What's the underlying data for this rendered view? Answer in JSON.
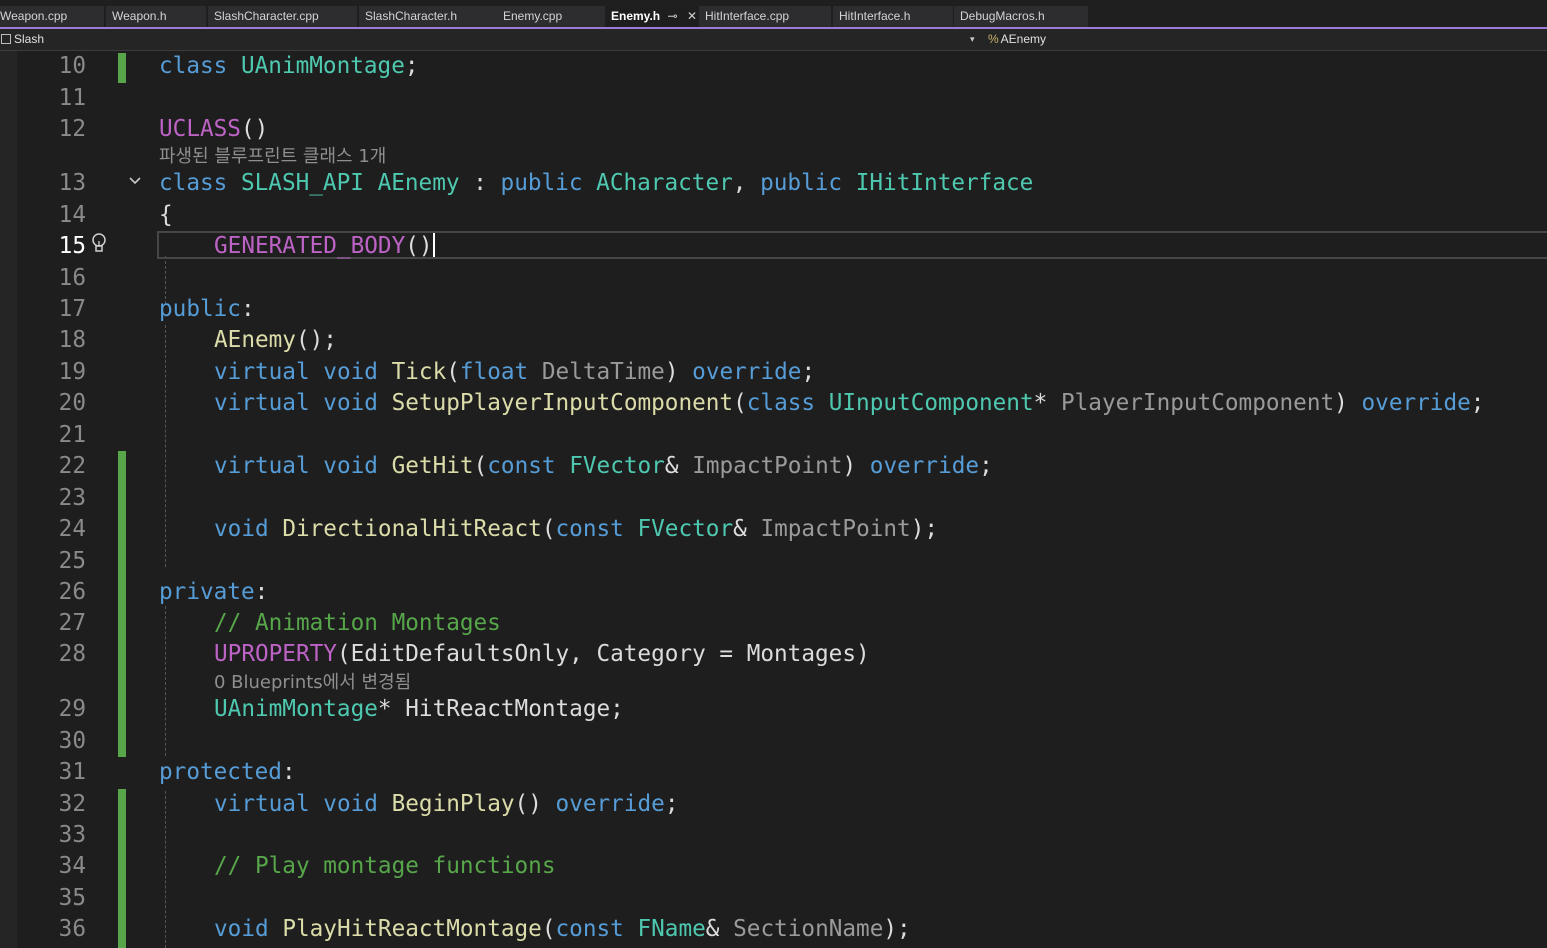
{
  "tabs": [
    {
      "label": "Weapon.cpp"
    },
    {
      "label": "Weapon.h"
    },
    {
      "label": "SlashCharacter.cpp"
    },
    {
      "label": "SlashCharacter.h"
    },
    {
      "label": "Enemy.cpp"
    },
    {
      "label": "Enemy.h",
      "active": true,
      "pin": "⊸",
      "close": "✕"
    },
    {
      "label": "HitInterface.cpp"
    },
    {
      "label": "HitInterface.h"
    },
    {
      "label": "DebugMacros.h"
    }
  ],
  "navbar": {
    "project": "Slash",
    "dropdown_arrow": "▾",
    "member_icon": "%",
    "member": "AEnemy"
  },
  "hints": {
    "derived_blueprints": "파생된 블루프린트 클래스 1개",
    "blueprint_changes": "0 Blueprints에서 변경됨"
  },
  "lines": [
    {
      "n": "10"
    },
    {
      "n": "11"
    },
    {
      "n": "12"
    },
    {
      "n": "13"
    },
    {
      "n": "14"
    },
    {
      "n": "15"
    },
    {
      "n": "16"
    },
    {
      "n": "17"
    },
    {
      "n": "18"
    },
    {
      "n": "19"
    },
    {
      "n": "20"
    },
    {
      "n": "21"
    },
    {
      "n": "22"
    },
    {
      "n": "23"
    },
    {
      "n": "24"
    },
    {
      "n": "25"
    },
    {
      "n": "26"
    },
    {
      "n": "27"
    },
    {
      "n": "28"
    },
    {
      "n": "29"
    },
    {
      "n": "30"
    },
    {
      "n": "31"
    },
    {
      "n": "32"
    },
    {
      "n": "33"
    },
    {
      "n": "34"
    },
    {
      "n": "35"
    },
    {
      "n": "36"
    }
  ],
  "code": {
    "l10": [
      "class",
      "UAnimMontage",
      ";"
    ],
    "l12": [
      "UCLASS",
      "()"
    ],
    "l13": [
      "class",
      "SLASH_API",
      "AEnemy",
      " : ",
      "public",
      "ACharacter",
      ", ",
      "public",
      "IHitInterface"
    ],
    "l14": [
      "{"
    ],
    "l15": [
      "GENERATED_BODY",
      "()"
    ],
    "l17": [
      "public",
      ":"
    ],
    "l18": [
      "AEnemy",
      "();"
    ],
    "l19": [
      "virtual",
      "void",
      "Tick",
      "(",
      "float",
      "DeltaTime",
      ")",
      "override",
      ";"
    ],
    "l20": [
      "virtual",
      "void",
      "SetupPlayerInputComponent",
      "(",
      "class",
      "UInputComponent",
      "*",
      "PlayerInputComponent",
      ")",
      "override",
      ";"
    ],
    "l22": [
      "virtual",
      "void",
      "GetHit",
      "(",
      "const",
      "FVector",
      "&",
      "ImpactPoint",
      ")",
      "override",
      ";"
    ],
    "l24": [
      "void",
      "DirectionalHitReact",
      "(",
      "const",
      "FVector",
      "&",
      "ImpactPoint",
      ");"
    ],
    "l26": [
      "private",
      ":"
    ],
    "l27": [
      "// Animation Montages"
    ],
    "l28": [
      "UPROPERTY",
      "(EditDefaultsOnly, Category = Montages)"
    ],
    "l29": [
      "UAnimMontage",
      "*",
      "HitReactMontage",
      ";"
    ],
    "l31": [
      "protected",
      ":"
    ],
    "l32": [
      "virtual",
      "void",
      "BeginPlay",
      "()",
      "override",
      ";"
    ],
    "l34": [
      "// Play montage functions"
    ],
    "l36": [
      "void",
      "PlayHitReactMontage",
      "(",
      "const",
      "FName",
      "&",
      "SectionName",
      ");"
    ]
  },
  "colors": {
    "keyword": "#569cd6",
    "type": "#4ec9b0",
    "function": "#dcdcaa",
    "macro": "#bd63c5",
    "comment": "#57a64a",
    "change_bar": "#57a64a",
    "tab_accent": "#9a7bd6"
  }
}
